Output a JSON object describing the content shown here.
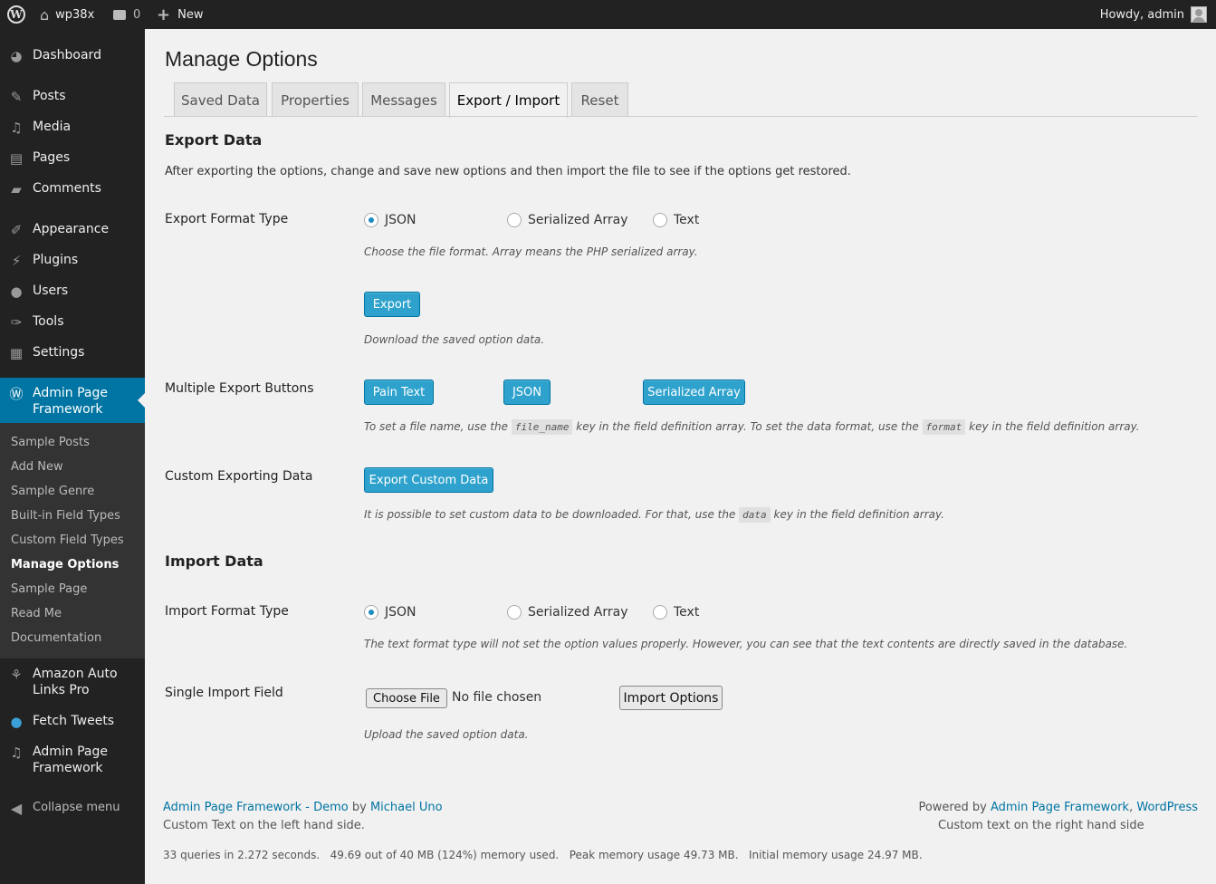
{
  "adminbar": {
    "site_name": "wp38x",
    "comments_count": "0",
    "new_label": "New",
    "howdy": "Howdy, admin"
  },
  "sidebar": {
    "items": [
      {
        "label": "Dashboard",
        "icon": "dashboard-icon"
      },
      {
        "label": "Posts",
        "icon": "pin-icon"
      },
      {
        "label": "Media",
        "icon": "media-icon"
      },
      {
        "label": "Pages",
        "icon": "pages-icon"
      },
      {
        "label": "Comments",
        "icon": "comment-icon"
      },
      {
        "label": "Appearance",
        "icon": "brush-icon"
      },
      {
        "label": "Plugins",
        "icon": "plugin-icon"
      },
      {
        "label": "Users",
        "icon": "user-icon"
      },
      {
        "label": "Tools",
        "icon": "wrench-icon"
      },
      {
        "label": "Settings",
        "icon": "settings-icon"
      },
      {
        "label": "Admin Page Framework",
        "icon": "wordpress-icon"
      },
      {
        "label": "Amazon Auto Links Pro",
        "icon": "amazon-icon"
      },
      {
        "label": "Fetch Tweets",
        "icon": "twitter-icon"
      },
      {
        "label": "Admin Page Framework",
        "icon": "music-icon"
      }
    ],
    "submenu": [
      "Sample Posts",
      "Add New",
      "Sample Genre",
      "Built-in Field Types",
      "Custom Field Types",
      "Manage Options",
      "Sample Page",
      "Read Me",
      "Documentation"
    ],
    "collapse_label": "Collapse menu"
  },
  "page": {
    "title": "Manage Options",
    "tabs": [
      "Saved Data",
      "Properties",
      "Messages",
      "Export / Import",
      "Reset"
    ],
    "active_tab": "Export / Import"
  },
  "export": {
    "heading": "Export Data",
    "intro": "After exporting the options, change and save new options and then import the file to see if the options get restored.",
    "format_label": "Export Format Type",
    "format_options": [
      "JSON",
      "Serialized Array",
      "Text"
    ],
    "format_selected": "JSON",
    "format_desc": "Choose the file format. Array means the PHP serialized array.",
    "export_button": "Export",
    "export_desc": "Download the saved option data.",
    "multi_label": "Multiple Export Buttons",
    "multi_buttons": [
      "Pain Text",
      "JSON",
      "Serialized Array"
    ],
    "multi_desc_1": "To set a file name, use the",
    "multi_code_1": "file_name",
    "multi_desc_2": "key in the field definition array. To set the data format, use the",
    "multi_code_2": "format",
    "multi_desc_3": "key in the field definition array.",
    "custom_label": "Custom Exporting Data",
    "custom_button": "Export Custom Data",
    "custom_desc_1": "It is possible to set custom data to be downloaded. For that, use the",
    "custom_code": "data",
    "custom_desc_2": "key in the field definition array."
  },
  "import": {
    "heading": "Import Data",
    "format_label": "Import Format Type",
    "format_options": [
      "JSON",
      "Serialized Array",
      "Text"
    ],
    "format_selected": "JSON",
    "format_desc": "The text format type will not set the option values properly. However, you can see that the text contents are directly saved in the database.",
    "field_label": "Single Import Field",
    "choose_file": "Choose File",
    "no_file": "No file chosen",
    "import_button": "Import Options",
    "field_desc": "Upload the saved option data."
  },
  "footer": {
    "left_link_1": "Admin Page Framework - Demo",
    "left_by": "by",
    "left_link_2": "Michael Uno",
    "left_custom": "Custom Text on the left hand side.",
    "right_powered": "Powered by",
    "right_link_1": "Admin Page Framework",
    "right_sep": ",",
    "right_link_2": "WordPress",
    "right_custom": "Custom text on the right hand side",
    "stats": "33 queries in 2.272 seconds.   49.69 out of 40 MB (124%) memory used.   Peak memory usage 49.73 MB.   Initial memory usage 24.97 MB."
  },
  "colors": {
    "accent": "#0074a2",
    "button_primary": "#2ea2cc",
    "sidebar_bg": "#222222",
    "submenu_bg": "#333333"
  }
}
